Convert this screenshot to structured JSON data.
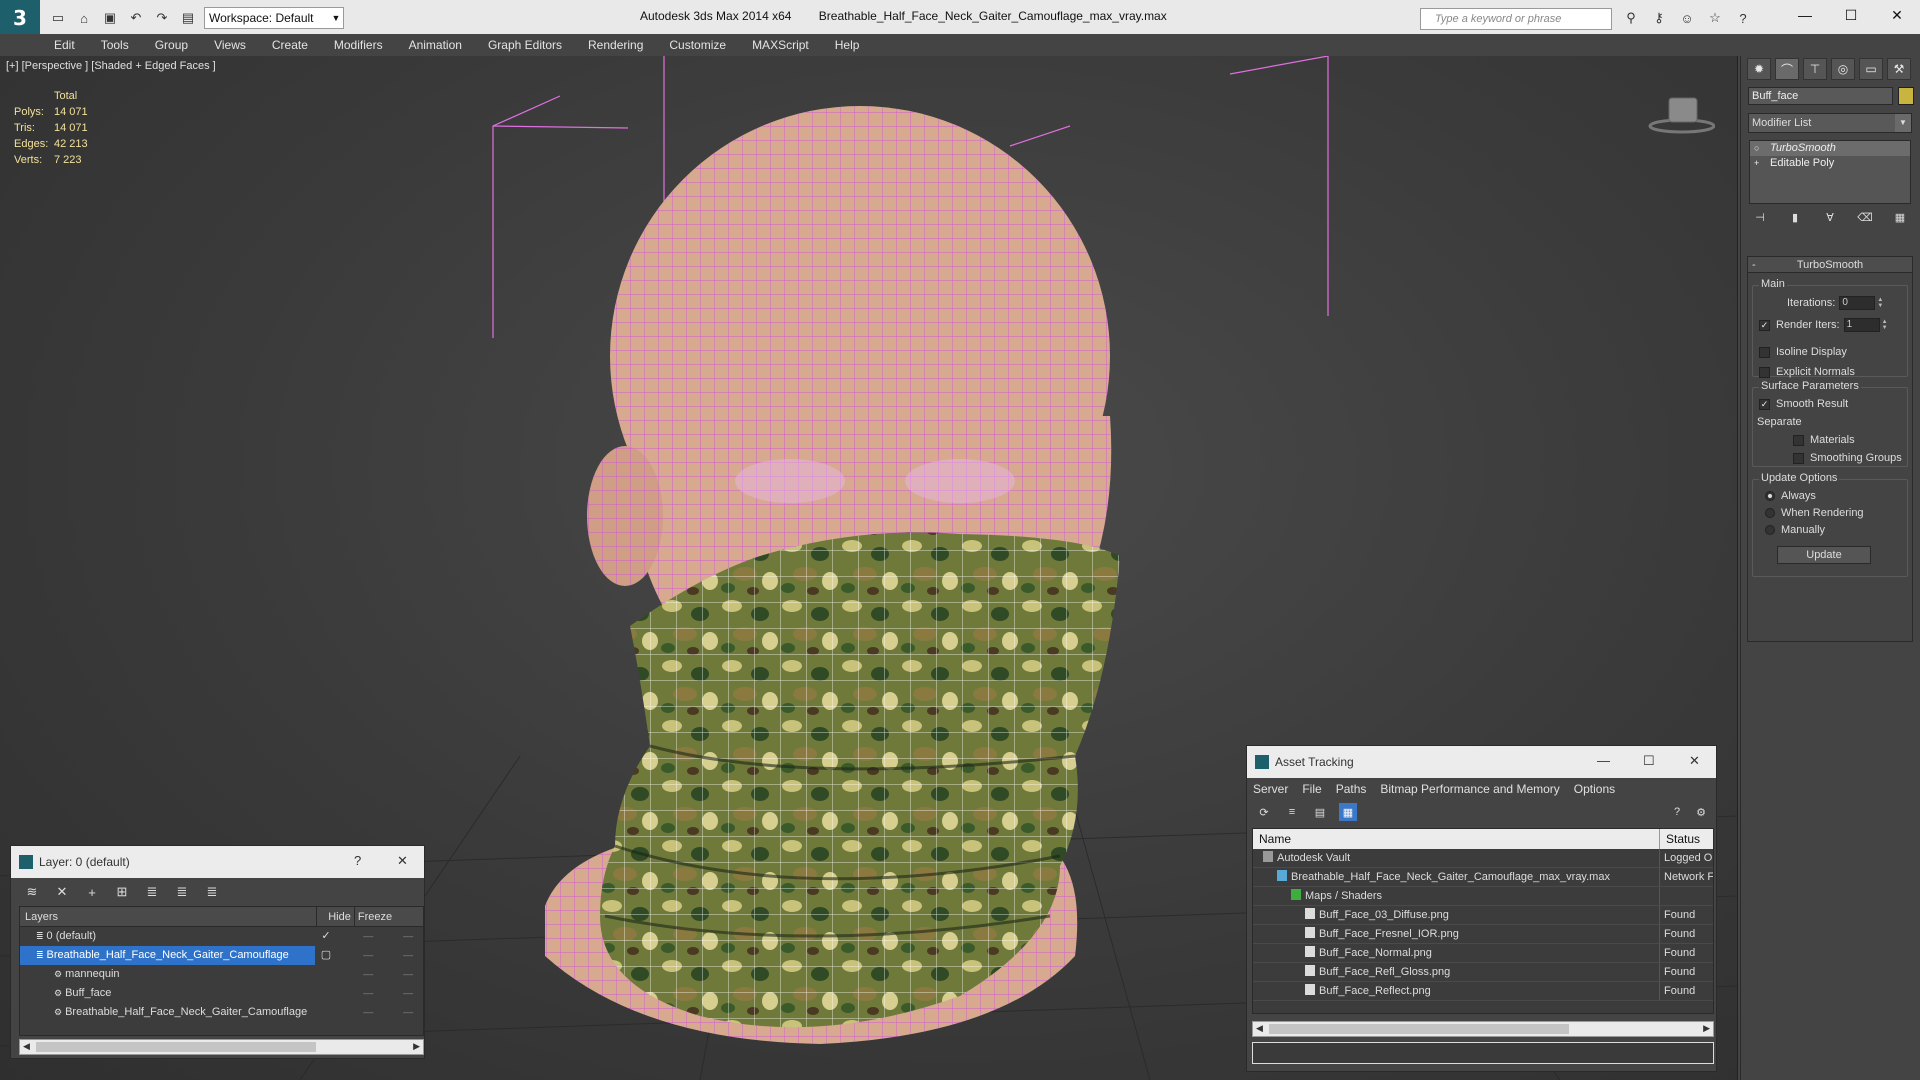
{
  "window": {
    "app_title": "Autodesk 3ds Max  2014 x64",
    "file_title": "Breathable_Half_Face_Neck_Gaiter_Camouflage_max_vray.max",
    "workspace": "Workspace: Default",
    "search_placeholder": "Type a keyword or phrase"
  },
  "menu": [
    "Edit",
    "Tools",
    "Group",
    "Views",
    "Create",
    "Modifiers",
    "Animation",
    "Graph Editors",
    "Rendering",
    "Customize",
    "MAXScript",
    "Help"
  ],
  "viewport": {
    "label": "[+] [Perspective ] [Shaded + Edged Faces ]",
    "stats_header": "Total",
    "stats": [
      {
        "k": "Polys:",
        "v": "14 071"
      },
      {
        "k": "Tris:",
        "v": "14 071"
      },
      {
        "k": "Edges:",
        "v": "42 213"
      },
      {
        "k": "Verts:",
        "v": "7 223"
      }
    ]
  },
  "command_panel": {
    "object_name": "Buff_face",
    "object_color": "#c8b540",
    "modifier_list": "Modifier List",
    "stack": [
      {
        "label": "TurboSmooth",
        "selected": true
      },
      {
        "label": "Editable Poly",
        "selected": false
      }
    ],
    "rollout_title": "TurboSmooth",
    "main_group": "Main",
    "iterations_label": "Iterations:",
    "iterations_value": "0",
    "render_iters_label": "Render Iters:",
    "render_iters_value": "1",
    "isoline": "Isoline Display",
    "explicit_normals": "Explicit Normals",
    "surface_group": "Surface Parameters",
    "smooth_result": "Smooth Result",
    "separate": "Separate",
    "materials": "Materials",
    "smoothing_groups": "Smoothing Groups",
    "update_group": "Update Options",
    "always": "Always",
    "when_rendering": "When Rendering",
    "manually": "Manually",
    "update_button": "Update"
  },
  "layer_dialog": {
    "title": "Layer: 0 (default)",
    "help": "?",
    "col_layers": "Layers",
    "col_hide": "Hide",
    "col_freeze": "Freeze",
    "rows": [
      {
        "name": "0 (default)",
        "indent": 1,
        "selected": false,
        "check": "✓"
      },
      {
        "name": "Breathable_Half_Face_Neck_Gaiter_Camouflage",
        "indent": 1,
        "selected": true,
        "check": "▢"
      },
      {
        "name": "mannequin",
        "indent": 2,
        "selected": false,
        "check": ""
      },
      {
        "name": "Buff_face",
        "indent": 2,
        "selected": false,
        "check": ""
      },
      {
        "name": "Breathable_Half_Face_Neck_Gaiter_Camouflage",
        "indent": 2,
        "selected": false,
        "check": ""
      }
    ]
  },
  "asset_tracking": {
    "title": "Asset Tracking",
    "menus": [
      "Server",
      "File",
      "Paths",
      "Bitmap Performance and Memory",
      "Options"
    ],
    "col_name": "Name",
    "col_status": "Status",
    "rows": [
      {
        "name": "Autodesk Vault",
        "indent": 1,
        "status": "Logged O"
      },
      {
        "name": "Breathable_Half_Face_Neck_Gaiter_Camouflage_max_vray.max",
        "indent": 2,
        "status": "Network F"
      },
      {
        "name": "Maps / Shaders",
        "indent": 3,
        "status": ""
      },
      {
        "name": "Buff_Face_03_Diffuse.png",
        "indent": 4,
        "status": "Found"
      },
      {
        "name": "Buff_Face_Fresnel_IOR.png",
        "indent": 4,
        "status": "Found"
      },
      {
        "name": "Buff_Face_Normal.png",
        "indent": 4,
        "status": "Found"
      },
      {
        "name": "Buff_Face_Refl_Gloss.png",
        "indent": 4,
        "status": "Found"
      },
      {
        "name": "Buff_Face_Reflect.png",
        "indent": 4,
        "status": "Found"
      }
    ]
  }
}
